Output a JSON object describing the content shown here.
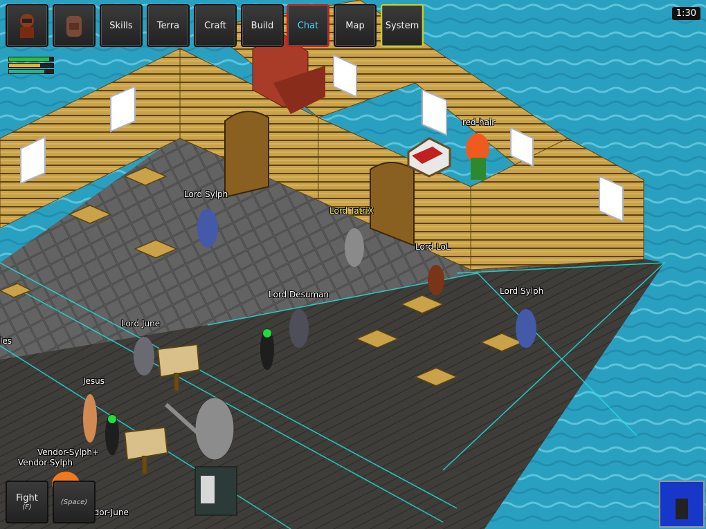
{
  "hud": {
    "buttons": [
      {
        "id": "avatar",
        "icon": "character-portrait-icon"
      },
      {
        "id": "inventory",
        "icon": "backpack-icon"
      },
      {
        "id": "skills",
        "label": "Skills"
      },
      {
        "id": "terra",
        "label": "Terra"
      },
      {
        "id": "craft",
        "label": "Craft"
      },
      {
        "id": "build",
        "label": "Build"
      },
      {
        "id": "chat",
        "label": "Chat",
        "active": true
      },
      {
        "id": "map",
        "label": "Map"
      },
      {
        "id": "system",
        "label": "System"
      }
    ],
    "timer": "1:30",
    "bars": [
      {
        "name": "health",
        "fill": 0.9,
        "color": "#2bbf3a"
      },
      {
        "name": "stamina",
        "fill": 0.7,
        "color": "#e7b21b"
      },
      {
        "name": "mana",
        "fill": 0.8,
        "color": "#1fb38f"
      }
    ]
  },
  "names": {
    "red_hair": "red-hair",
    "lord_sylph_1": "Lord Sylph",
    "lord_tatrix": "Lord TatriX",
    "lord_lol": "Lord LoL",
    "lord_desuman": "Lord Desuman",
    "lord_sylph_2": "Lord Sylph",
    "lord_june": "Lord June",
    "jesus": "Jesus",
    "vendor_sylph_plus": "Vendor-Sylph+",
    "vendor_sylph": "Vendor-Sylph",
    "partial_les": "les",
    "partial_june": "ndor-June"
  },
  "bottom": {
    "fight_label": "Fight",
    "fight_hint": "(F)",
    "space_hint": "(Space)"
  },
  "colors": {
    "water": "#2aa0c0",
    "floor": "#5a5a5a",
    "wood": "#c9a24a",
    "accent_chat": "#3fd8ff",
    "grid_line": "#22e0e0"
  }
}
